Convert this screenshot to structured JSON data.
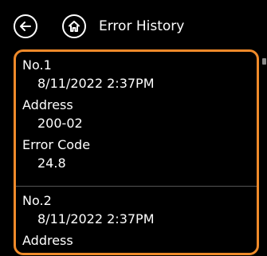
{
  "header": {
    "back_icon": "arrow-left-icon",
    "home_icon": "home-icon",
    "title": "Error History"
  },
  "colors": {
    "accent": "#ef8a2a",
    "background": "#000000",
    "text": "#ffffff"
  },
  "entries": [
    {
      "number": "No.1",
      "datetime": "8/11/2022 2:37PM",
      "address_label": "Address",
      "address": "200-02",
      "error_code_label": "Error Code",
      "error_code": "24.8"
    },
    {
      "number": "No.2",
      "datetime": "8/11/2022 2:37PM",
      "address_label": "Address"
    }
  ]
}
